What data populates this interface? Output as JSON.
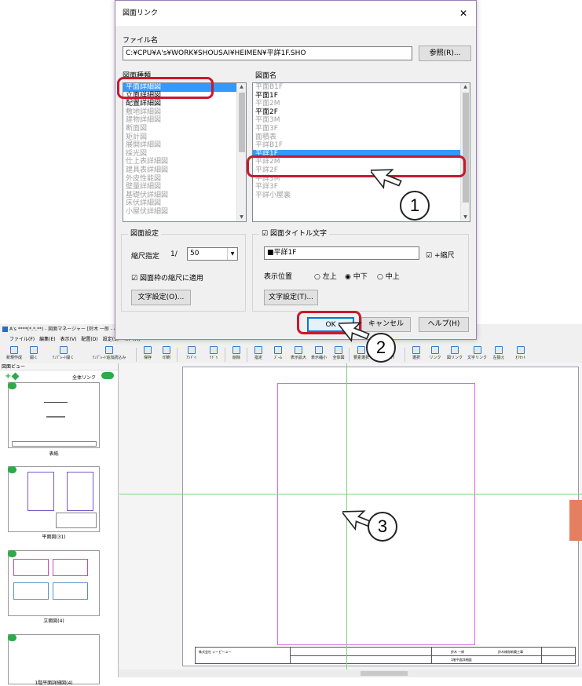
{
  "app": {
    "title": "A's ****(*,*,**) - 図面マネージャー [鈴木 一郎 - 4_1 階平...",
    "menu": [
      "ファイル(F)",
      "編集(E)",
      "表示(V)",
      "配置(D)",
      "設定(S)",
      "ﾍﾙﾌﾟ(H)"
    ],
    "toolbar": [
      "新規作成",
      "開く",
      "ﾃﾝﾌﾟﾚｰﾄ開く",
      "ﾃﾝﾌﾟﾚｰﾄ追加読込み",
      "保存",
      "印刷",
      "ｱﾝﾄﾞｩ",
      "ﾘﾄﾞｩ",
      "削除",
      "指定",
      "ｽﾞｰﾑ",
      "表示拡大",
      "表示縮小",
      "全体図",
      "要素選択",
      "ｸﾞﾗﾌｨｯｸ",
      "選択",
      "リンク",
      "図リンク",
      "文字リンク",
      "左揃え",
      "ｵﾌｾｯﾄ"
    ]
  },
  "left_panel": {
    "header": "図面ビュー",
    "all_link_label": "全体リンク",
    "thumbnails": [
      {
        "label": "表紙"
      },
      {
        "label": "平面図(31)"
      },
      {
        "label": "立面図(4)"
      },
      {
        "label": "1階平面詳細図(4)"
      }
    ]
  },
  "title_block": {
    "company": "株式会社 シーピーユー",
    "name": "鈴木 一郎",
    "project": "鈴木様邸新築工事",
    "drawing": "1階平面詳細図"
  },
  "dialog": {
    "title": "図面リンク",
    "close_icon": "close-icon",
    "file_label": "ファイル名",
    "file_value": "C:¥CPU¥A's¥WORK¥SHOUSAI¥HEIMEN¥平詳1F.SHO",
    "browse_button": "参照(R)...",
    "type_label": "図面種類",
    "types": [
      {
        "text": "平面詳細図",
        "state": "sel"
      },
      {
        "text": "立面詳細図",
        "state": "norm"
      },
      {
        "text": "配置詳細図",
        "state": "norm"
      },
      {
        "text": "敷地詳細図",
        "state": "dis"
      },
      {
        "text": "建物詳細図",
        "state": "dis"
      },
      {
        "text": "断面図",
        "state": "dis"
      },
      {
        "text": "矩計図",
        "state": "dis"
      },
      {
        "text": "展開詳細図",
        "state": "dis"
      },
      {
        "text": "採光図",
        "state": "dis"
      },
      {
        "text": "仕上表詳細図",
        "state": "dis"
      },
      {
        "text": "建具表詳細図",
        "state": "dis"
      },
      {
        "text": "外皮性能図",
        "state": "dis"
      },
      {
        "text": "壁量詳細図",
        "state": "dis"
      },
      {
        "text": "基礎伏詳細図",
        "state": "dis"
      },
      {
        "text": "床伏詳細図",
        "state": "dis"
      },
      {
        "text": "小屋伏詳細図",
        "state": "dis"
      }
    ],
    "name_label": "図面名",
    "names": [
      {
        "text": "平面B1F",
        "state": "dis"
      },
      {
        "text": "平面1F",
        "state": "norm"
      },
      {
        "text": "平面2M",
        "state": "dis"
      },
      {
        "text": "平面2F",
        "state": "norm"
      },
      {
        "text": "平面3M",
        "state": "dis"
      },
      {
        "text": "平面3F",
        "state": "dis"
      },
      {
        "text": "面積表",
        "state": "dis"
      },
      {
        "text": "平詳B1F",
        "state": "dis"
      },
      {
        "text": "平詳1F",
        "state": "sel"
      },
      {
        "text": "平詳2M",
        "state": "dis"
      },
      {
        "text": "平詳2F",
        "state": "dis"
      },
      {
        "text": "平詳3M",
        "state": "dis"
      },
      {
        "text": "平詳3F",
        "state": "dis"
      },
      {
        "text": "平詳小屋裏",
        "state": "dis"
      }
    ],
    "settings_group": "図面設定",
    "scale_label": "縮尺指定",
    "scale_prefix": "1/",
    "scale_value": "50",
    "frame_scale_check": "図面枠の縮尺に適用",
    "text_settings_button": "文字設定(O)...",
    "title_text_group": "図面タイトル文字",
    "title_text_value": "■平詳1F",
    "plus_scale_check": "+縮尺",
    "position_label": "表示位置",
    "positions": [
      "左上",
      "中下",
      "中上"
    ],
    "position_selected": "中下",
    "text_settings_button2": "文字設定(T)...",
    "ok_button": "OK",
    "cancel_button": "キャンセル",
    "help_button": "ヘルプ(H)"
  },
  "callouts": [
    "1",
    "2",
    "3"
  ],
  "colors": {
    "highlight_ring": "#c8192e",
    "selection": "#3399ff",
    "accent_orange": "#e57f61",
    "link_green": "#2daa4a"
  }
}
